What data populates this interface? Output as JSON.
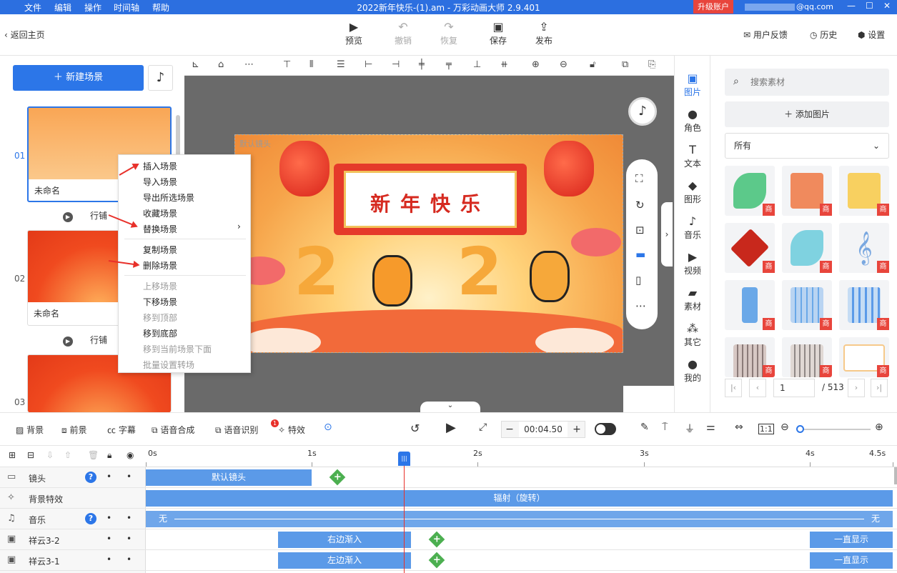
{
  "menubar": {
    "items": [
      "文件",
      "编辑",
      "操作",
      "时间轴",
      "帮助"
    ],
    "title": "2022新年快乐-(1).am - 万彩动画大师 2.9.401",
    "upgrade": "升级账户",
    "account": "@qq.com"
  },
  "toolbar": {
    "back": "返回主页",
    "preview": "预览",
    "undo": "撤销",
    "redo": "恢复",
    "save": "保存",
    "publish": "发布",
    "feedback": "用户反馈",
    "history": "历史",
    "settings": "设置"
  },
  "scenes": {
    "new_scene": "新建场景",
    "items": [
      {
        "num": "01",
        "name": "未命名",
        "transition": "行铺"
      },
      {
        "num": "02",
        "name": "未命名",
        "transition": "行铺"
      },
      {
        "num": "03",
        "name": "",
        "transition": ""
      }
    ]
  },
  "context_menu": {
    "group1": [
      "插入场景",
      "导入场景",
      "导出所选场景",
      "收藏场景",
      "替换场景"
    ],
    "group2": [
      "复制场景",
      "删除场景"
    ],
    "group3": [
      {
        "label": "上移场景",
        "enabled": false
      },
      {
        "label": "下移场景",
        "enabled": true
      },
      {
        "label": "移到顶部",
        "enabled": false
      },
      {
        "label": "移到底部",
        "enabled": true
      },
      {
        "label": "移到当前场景下面",
        "enabled": false
      },
      {
        "label": "批量设置转场",
        "enabled": false
      }
    ],
    "submenu_arrow": "›"
  },
  "canvas": {
    "camera_label": "默认镜头",
    "banner": "新年快乐",
    "digits": [
      "2",
      "2"
    ]
  },
  "assets_tabs": [
    {
      "label": "图片",
      "icon": "image-icon",
      "active": true
    },
    {
      "label": "角色",
      "icon": "person-icon",
      "active": false
    },
    {
      "label": "文本",
      "icon": "text-icon",
      "active": false
    },
    {
      "label": "图形",
      "icon": "shape-icon",
      "active": false
    },
    {
      "label": "音乐",
      "icon": "music-icon",
      "active": false
    },
    {
      "label": "视频",
      "icon": "video-icon",
      "active": false
    },
    {
      "label": "素材",
      "icon": "folder-icon",
      "active": false
    },
    {
      "label": "其它",
      "icon": "grid-icon",
      "active": false
    },
    {
      "label": "我的",
      "icon": "user-icon",
      "active": false
    }
  ],
  "asset_panel": {
    "search_placeholder": "搜索素材",
    "add_image": "添加图片",
    "filter": "所有",
    "badge": "商",
    "page": "1",
    "total": "/ 513"
  },
  "timeline_toolbar": {
    "background": "背景",
    "foreground": "前景",
    "subtitle": "字幕",
    "tts": "语音合成",
    "asr": "语音识别",
    "asr_badge": "1",
    "effects": "特效",
    "time": "00:04.50",
    "minus": "−",
    "plus": "+"
  },
  "ruler": [
    "0s",
    "1s",
    "2s",
    "3s",
    "4s",
    "4.5s"
  ],
  "tracks": [
    {
      "name": "镜头",
      "help": true,
      "clips": [
        {
          "label": "默认镜头"
        }
      ]
    },
    {
      "name": "背景特效",
      "help": false,
      "clips": [
        {
          "label": "辐射（旋转）"
        }
      ]
    },
    {
      "name": "音乐",
      "help": true,
      "clips": [
        {
          "label": "无"
        },
        {
          "label": "无"
        }
      ]
    },
    {
      "name": "祥云3-2",
      "help": false,
      "clips": [
        {
          "label": "右边渐入"
        },
        {
          "label": "一直显示"
        }
      ]
    },
    {
      "name": "祥云3-1",
      "help": false,
      "clips": [
        {
          "label": "左边渐入"
        },
        {
          "label": "一直显示"
        }
      ]
    }
  ],
  "colors": {
    "accent": "#2c76e8",
    "titlebar": "#2c6fe0",
    "danger": "#e8453c",
    "clip": "#5b9ae8"
  }
}
